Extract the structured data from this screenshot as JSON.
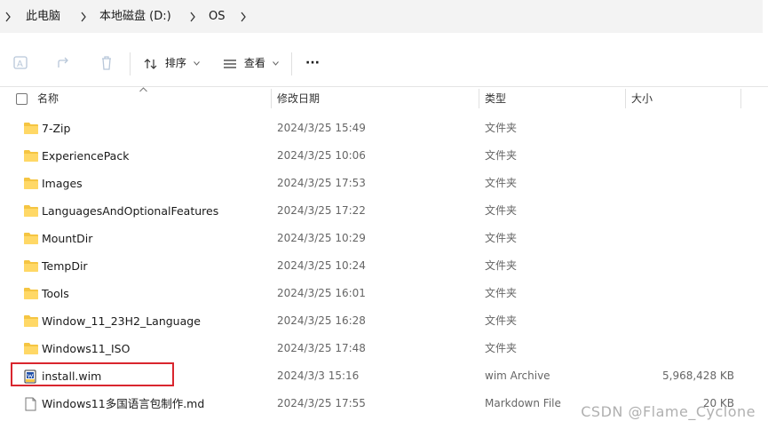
{
  "breadcrumb": {
    "items": [
      "此电脑",
      "本地磁盘 (D:)",
      "OS"
    ]
  },
  "toolbar": {
    "sort_label": "排序",
    "view_label": "查看",
    "more_label": "···"
  },
  "columns": {
    "name": "名称",
    "modified": "修改日期",
    "type": "类型",
    "size": "大小"
  },
  "files": [
    {
      "name": "7-Zip",
      "modified": "2024/3/25 15:49",
      "type": "文件夹",
      "size": "",
      "icon": "folder-icon"
    },
    {
      "name": "ExperiencePack",
      "modified": "2024/3/25 10:06",
      "type": "文件夹",
      "size": "",
      "icon": "folder-icon"
    },
    {
      "name": "Images",
      "modified": "2024/3/25 17:53",
      "type": "文件夹",
      "size": "",
      "icon": "folder-icon"
    },
    {
      "name": "LanguagesAndOptionalFeatures",
      "modified": "2024/3/25 17:22",
      "type": "文件夹",
      "size": "",
      "icon": "folder-icon"
    },
    {
      "name": "MountDir",
      "modified": "2024/3/25 10:29",
      "type": "文件夹",
      "size": "",
      "icon": "folder-icon"
    },
    {
      "name": "TempDir",
      "modified": "2024/3/25 10:24",
      "type": "文件夹",
      "size": "",
      "icon": "folder-icon"
    },
    {
      "name": "Tools",
      "modified": "2024/3/25 16:01",
      "type": "文件夹",
      "size": "",
      "icon": "folder-icon"
    },
    {
      "name": "Window_11_23H2_Language",
      "modified": "2024/3/25 16:28",
      "type": "文件夹",
      "size": "",
      "icon": "folder-icon"
    },
    {
      "name": "Windows11_ISO",
      "modified": "2024/3/25 17:48",
      "type": "文件夹",
      "size": "",
      "icon": "folder-icon"
    },
    {
      "name": "install.wim",
      "modified": "2024/3/3 15:16",
      "type": "wim Archive",
      "size": "5,968,428 KB",
      "icon": "archive-file-icon"
    },
    {
      "name": "Windows11多国语言包制作.md",
      "modified": "2024/3/25 17:55",
      "type": "Markdown File",
      "size": "20 KB",
      "icon": "document-file-icon"
    }
  ],
  "watermark": "CSDN @Flame_Cyclone",
  "colors": {
    "folder": "#f5c542",
    "highlight_border": "#d9262e"
  }
}
